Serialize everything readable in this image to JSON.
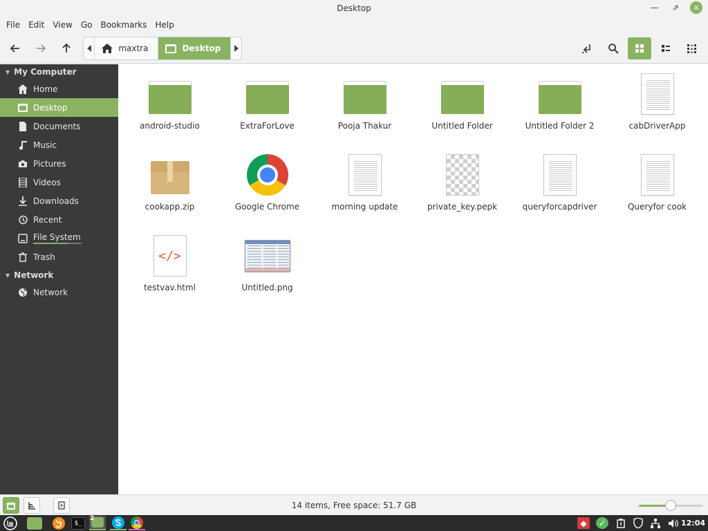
{
  "window": {
    "title": "Desktop"
  },
  "menubar": [
    "File",
    "Edit",
    "View",
    "Go",
    "Bookmarks",
    "Help"
  ],
  "pathbar": {
    "segments": [
      "maxtra",
      "Desktop"
    ]
  },
  "sidebar": {
    "sections": [
      {
        "heading": "My Computer",
        "items": [
          "Home",
          "Desktop",
          "Documents",
          "Music",
          "Pictures",
          "Videos",
          "Downloads",
          "Recent",
          "File System",
          "Trash"
        ]
      },
      {
        "heading": "Network",
        "items": [
          "Network"
        ]
      }
    ],
    "active_item": "Desktop",
    "filesystem_usage_fraction": 0.72
  },
  "files": [
    {
      "name": "android-studio",
      "type": "folder"
    },
    {
      "name": "ExtraForLove",
      "type": "folder"
    },
    {
      "name": "Pooja Thakur",
      "type": "folder"
    },
    {
      "name": "Untitled Folder",
      "type": "folder"
    },
    {
      "name": "Untitled Folder 2",
      "type": "folder"
    },
    {
      "name": "cabDriverApp",
      "type": "text"
    },
    {
      "name": "cookapp.zip",
      "type": "archive"
    },
    {
      "name": "Google Chrome",
      "type": "chrome"
    },
    {
      "name": "morning update",
      "type": "text"
    },
    {
      "name": "private_key.pepk",
      "type": "transparent"
    },
    {
      "name": "queryforcapdriver",
      "type": "text"
    },
    {
      "name": "Queryfor cook",
      "type": "text"
    },
    {
      "name": "testvav.html",
      "type": "html"
    },
    {
      "name": "Untitled.png",
      "type": "image"
    }
  ],
  "status": {
    "text": "14 items, Free space: 51.7 GB",
    "zoom_fraction": 0.5
  },
  "taskbar": {
    "clock": "12:04",
    "workspace_badge": "2"
  },
  "colors": {
    "accent": "#8ab361",
    "sidebar_bg": "#3a3a3a",
    "folder": "#86ad58"
  }
}
